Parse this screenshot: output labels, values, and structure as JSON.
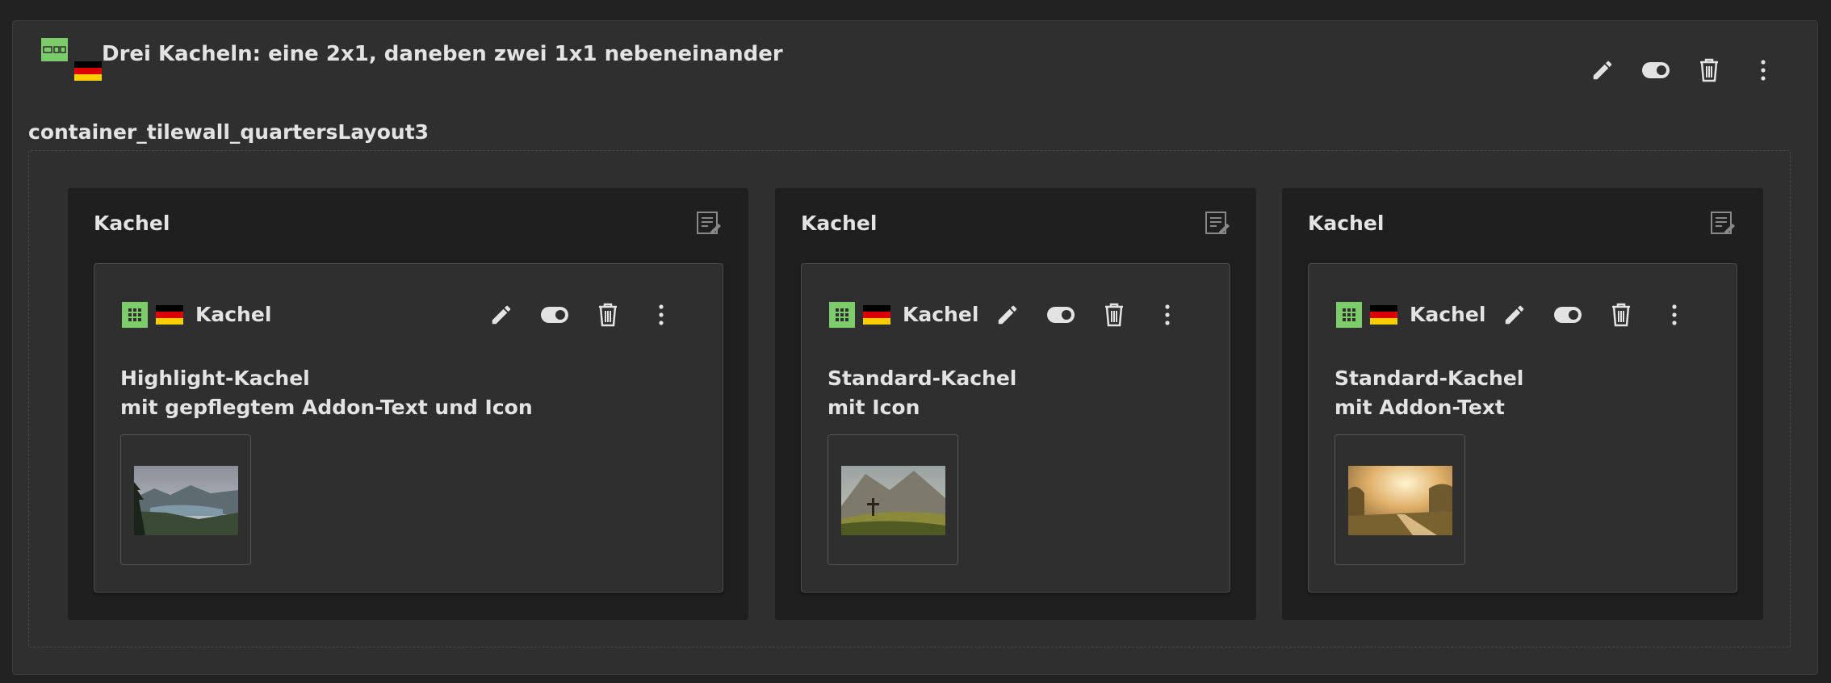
{
  "container": {
    "title": "Drei Kacheln: eine 2x1, daneben zwei 1x1 nebeneinander",
    "uid_label": "container_tilewall_quartersLayout3",
    "icon": "container-layout-icon",
    "language_flag": "german-flag-icon",
    "actions": [
      "edit-icon",
      "toggle-visibility-icon",
      "delete-icon",
      "more-options-icon"
    ]
  },
  "columns": [
    {
      "title": "Kachel",
      "card": {
        "title": "Kachel",
        "line1": "Highlight-Kachel",
        "line2": "mit gepflegtem Addon-Text und Icon",
        "thumbnail": "lake-mountain-landscape-image"
      }
    },
    {
      "title": "Kachel",
      "card": {
        "title": "Kachel",
        "line1": "Standard-Kachel",
        "line2": "mit Icon",
        "thumbnail": "mountain-cross-image"
      }
    },
    {
      "title": "Kachel",
      "card": {
        "title": "Kachel",
        "line1": "Standard-Kachel",
        "line2": "mit Addon-Text",
        "thumbnail": "sunlit-road-image"
      }
    }
  ],
  "colors": {
    "background": "#222222",
    "panel": "#2f2f2f",
    "column": "#1f1f1f",
    "text": "#e3e3e3",
    "icon_green": "#8ccf6c"
  }
}
